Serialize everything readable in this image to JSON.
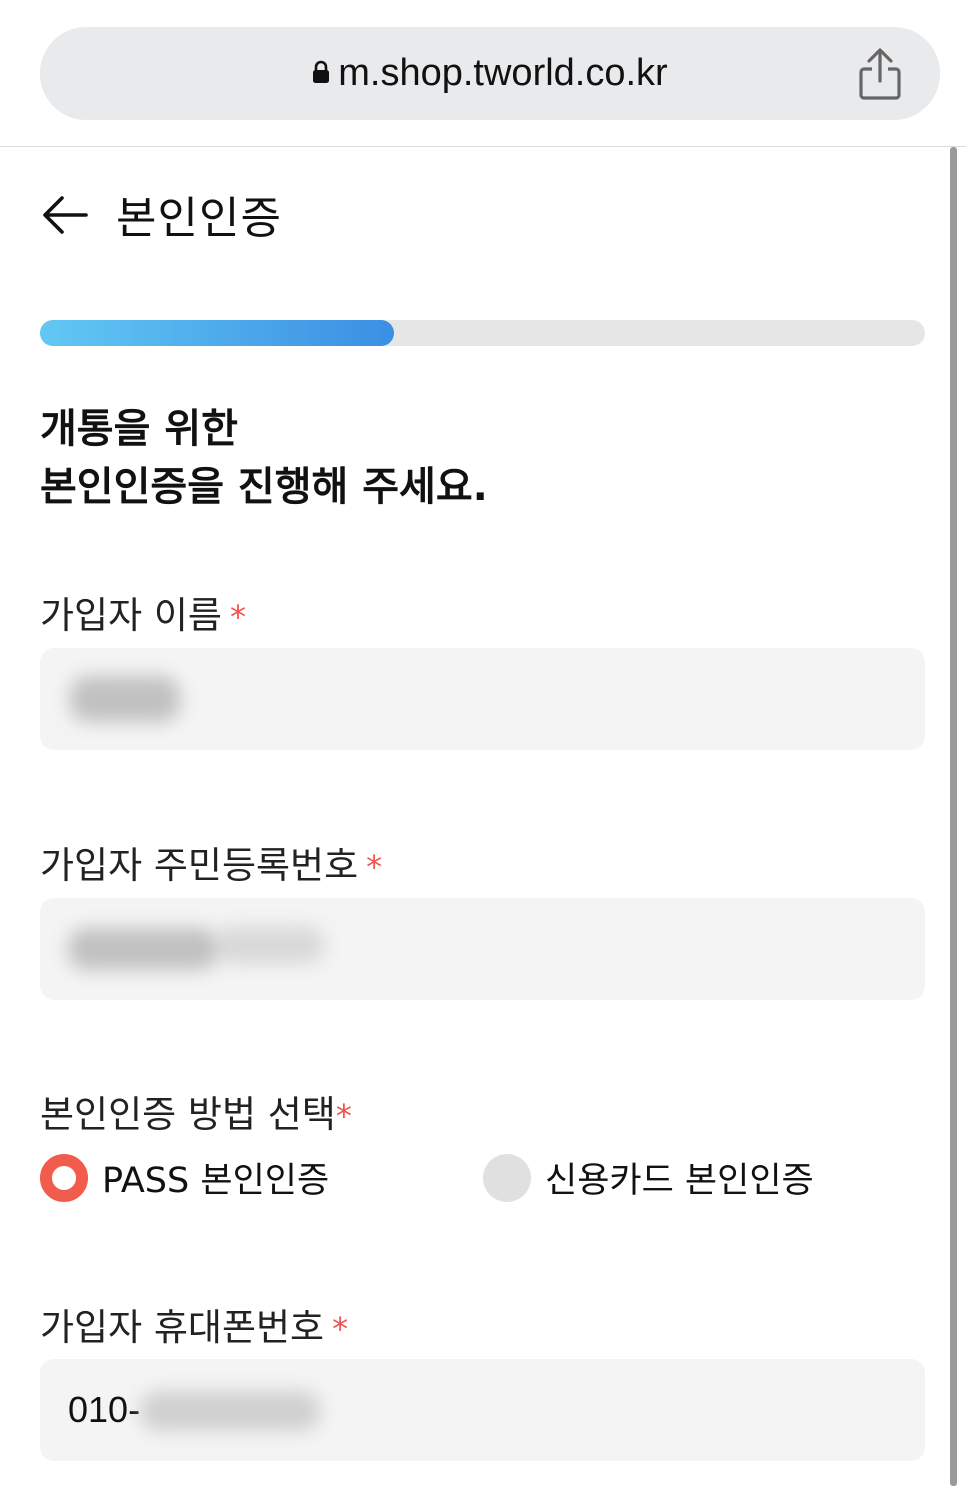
{
  "browser": {
    "url": "m.shop.tworld.co.kr",
    "lock_icon": "lock-icon",
    "share_icon": "share-icon"
  },
  "header": {
    "back_icon": "back-arrow-icon",
    "title": "본인인증"
  },
  "progress": {
    "value_percent": 40
  },
  "intro": {
    "line1": "개통을 위한",
    "line2": "본인인증을 진행해 주세요."
  },
  "form": {
    "required_mark": "*",
    "name_label": "가입자 이름",
    "rrn_label": "가입자 주민등록번호",
    "method_label": "본인인증 방법 선택",
    "method_options": [
      {
        "label": "PASS 본인인증",
        "selected": true
      },
      {
        "label": "신용카드 본인인증",
        "selected": false
      }
    ],
    "phone_label": "가입자 휴대폰번호",
    "phone_prefix": "010-"
  },
  "colors": {
    "accent": "#f25c4c",
    "progress_start": "#62c8f3",
    "progress_end": "#3b8fe3",
    "field_bg": "#f4f4f4"
  }
}
